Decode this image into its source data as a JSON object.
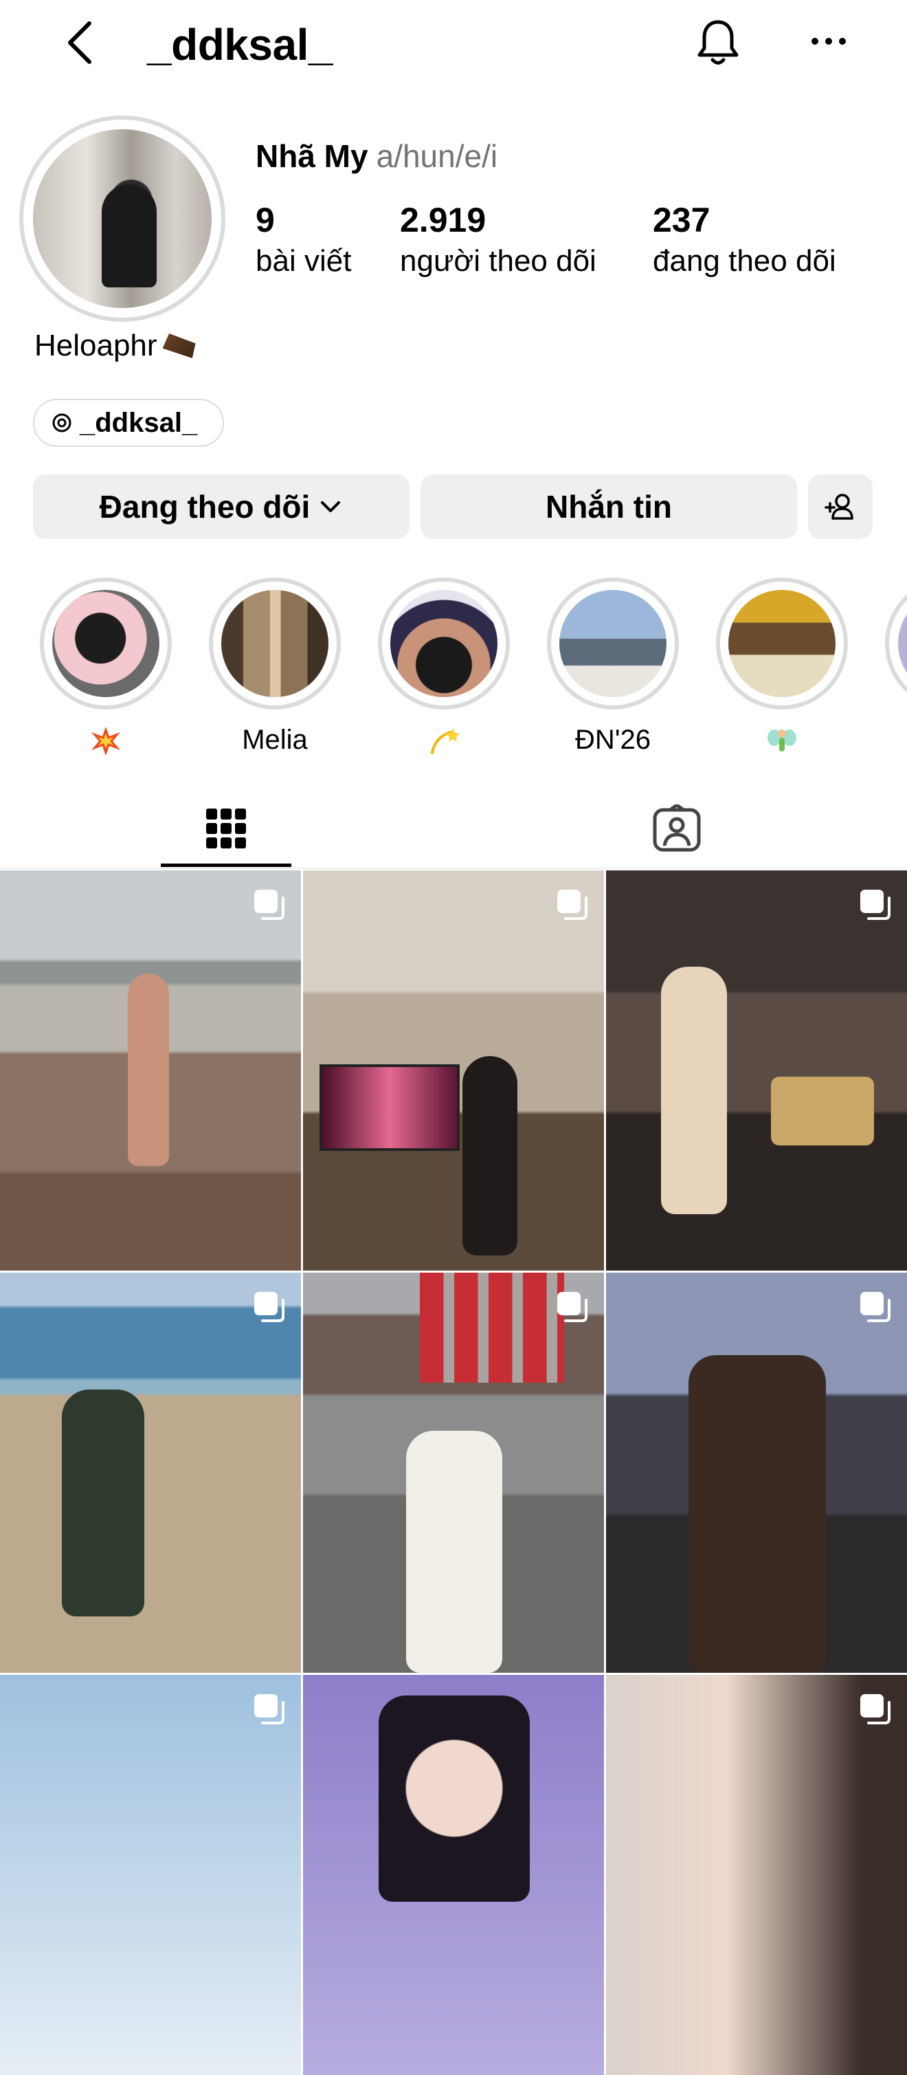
{
  "header": {
    "username": "_ddksal_",
    "icons": [
      "back-chevron-icon",
      "bell-icon",
      "more-icon"
    ]
  },
  "profile": {
    "full_name": "Nhã My",
    "pronouns": "a/hun/e/i",
    "stats": [
      {
        "value": "9",
        "label": "bài viết"
      },
      {
        "value": "2.919",
        "label": "người theo dõi"
      },
      {
        "value": "237",
        "label": "đang theo dõi"
      }
    ],
    "bio": "Heloaphr",
    "threads_handle": "_ddksal_"
  },
  "actions": {
    "follow_label": "Đang theo dõi",
    "message_label": "Nhắn tin"
  },
  "highlights": [
    {
      "label": "",
      "emoji": "collision"
    },
    {
      "label": "Melia",
      "emoji": ""
    },
    {
      "label": "",
      "emoji": "dizzy"
    },
    {
      "label": "ĐN'26",
      "emoji": ""
    },
    {
      "label": "",
      "emoji": "fairy"
    }
  ],
  "tabs": [
    "grid-icon",
    "tagged-icon"
  ],
  "colors": {
    "border": "#dbdbdb",
    "button_bg": "#efefef",
    "secondary_text": "#737373"
  },
  "posts": [
    {
      "name": "beach-photo"
    },
    {
      "name": "room-tv-photo"
    },
    {
      "name": "street-market-photo"
    },
    {
      "name": "hammock-beach-photo"
    },
    {
      "name": "white-dress-street-photo"
    },
    {
      "name": "balcony-portrait-photo"
    },
    {
      "name": "sky-photo"
    },
    {
      "name": "purple-portrait-photo"
    },
    {
      "name": "closeup-selfie-photo"
    }
  ]
}
